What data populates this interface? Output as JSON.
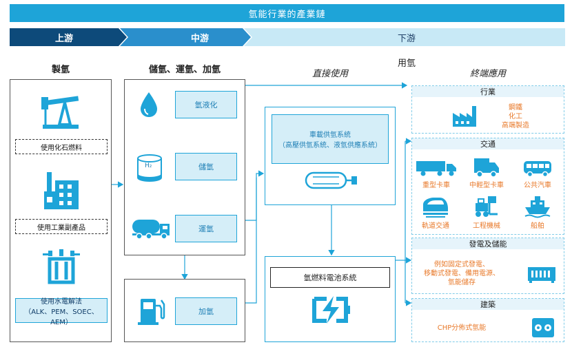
{
  "title": "氫能行業的產業鏈",
  "stages": {
    "upstream": "上游",
    "midstream": "中游",
    "downstream": "下游"
  },
  "columns": {
    "production": "製氫",
    "storage": "儲氫、運氫、加氫",
    "direct_use": "直接使用",
    "use_hydrogen": "用氫",
    "end_use": "終端應用"
  },
  "production": {
    "fossil": "使用化石燃料",
    "industrial": "使用工業副產品",
    "electrolysis_line1": "使用水電解法",
    "electrolysis_line2": "（ALK、PEM、SOEC、AEM）"
  },
  "storage": {
    "liquefaction": "氫液化",
    "storage": "儲氫",
    "transport": "運氫",
    "refueling": "加氫",
    "h2_label": "H₂"
  },
  "direct_use": {
    "vehicle_line1": "車載供氫系統",
    "vehicle_line2": "（高壓供氫系統、液氫供應系統）",
    "fuel_cell": "氫燃料電池系統"
  },
  "end_use": {
    "industry": {
      "title": "行業",
      "items": [
        "鋼鐵",
        "化工",
        "高端製造"
      ]
    },
    "transport": {
      "title": "交通",
      "items": [
        "重型卡車",
        "中輕型卡車",
        "公共汽車",
        "軌道交通",
        "工程機械",
        "船舶"
      ]
    },
    "power": {
      "title": "發電及儲能",
      "lines": [
        "例如固定式發電、",
        "移動式發電、備用電源、",
        "氫能儲存"
      ]
    },
    "building": {
      "title": "建築",
      "text": "CHP分佈式氫能"
    }
  },
  "colors": {
    "primary": "#1ea4d8",
    "dark": "#0d4a7a",
    "mid": "#2a8fcc",
    "light": "#d5eef8",
    "accent": "#e8792a"
  }
}
